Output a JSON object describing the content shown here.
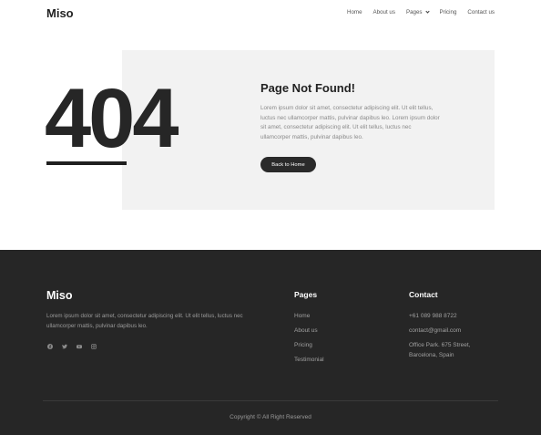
{
  "header": {
    "logo": "Miso",
    "nav": [
      {
        "label": "Home"
      },
      {
        "label": "About us"
      },
      {
        "label": "Pages",
        "has_dropdown": true
      },
      {
        "label": "Pricing"
      },
      {
        "label": "Contact us"
      }
    ]
  },
  "error": {
    "code": "404",
    "title": "Page Not Found!",
    "text": "Lorem ipsum dolor sit amet, consectetur adipiscing elit. Ut elit tellus, luctus nec ullamcorper mattis, pulvinar dapibus leo. Lorem ipsum dolor sit amet, consectetur adipiscing elit. Ut elit tellus, luctus nec ullamcorper mattis, pulvinar dapibus leo.",
    "button_label": "Back to Home"
  },
  "footer": {
    "logo": "Miso",
    "description": "Lorem ipsum dolor sit amet, consectetur adipiscing elit. Ut elit tellus, luctus nec ullamcorper mattis, pulvinar dapibus leo.",
    "socials": [
      "facebook-icon",
      "twitter-icon",
      "youtube-icon",
      "instagram-icon"
    ],
    "pages_title": "Pages",
    "pages": [
      "Home",
      "About us",
      "Pricing",
      "Testimonial"
    ],
    "contact_title": "Contact",
    "contact": [
      "+61 089 988 8722",
      "contact@gmail.com",
      "Office Park. 675 Street, Barcelona, Spain"
    ],
    "copyright": "Copyright © All Right Reserved"
  },
  "colors": {
    "dark": "#262626",
    "panel": "#f2f2f2",
    "muted_text": "#8a8a8a"
  }
}
